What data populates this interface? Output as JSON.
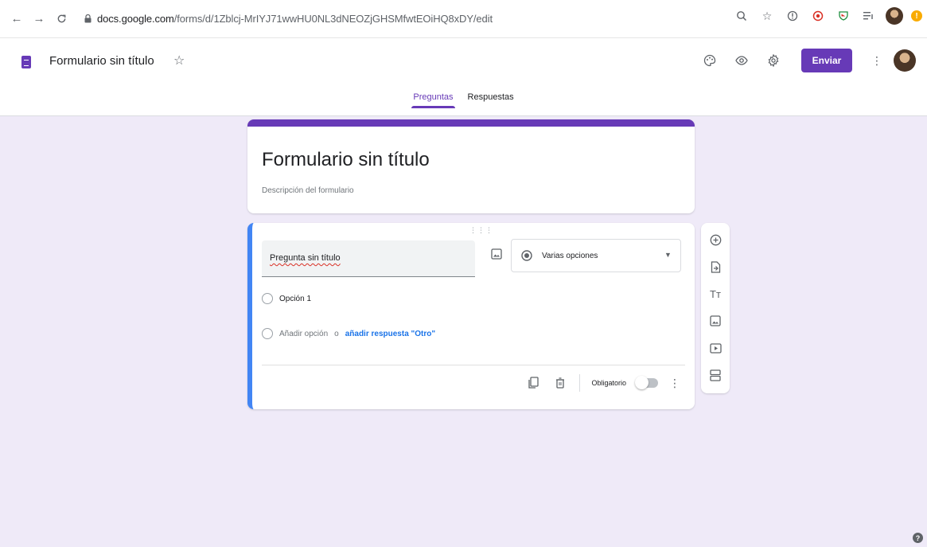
{
  "browser": {
    "url_host": "docs.google.com",
    "url_path": "/forms/d/1Zblcj-MrIYJ71wwHU0NL3dNEOZjGHSMfwtEOiHQ8xDY/edit",
    "icons": [
      "back-icon",
      "forward-icon",
      "reload-icon",
      "lock-icon",
      "zoom-icon",
      "star-icon",
      "extension-icons",
      "profile-avatar",
      "update-warning-icon"
    ],
    "warning_badge": "!"
  },
  "header": {
    "doc_title": "Formulario sin título",
    "send_label": "Enviar",
    "accent_color": "#673ab7",
    "tabs": [
      {
        "label": "Preguntas",
        "active": true
      },
      {
        "label": "Respuestas",
        "active": false
      }
    ]
  },
  "form": {
    "title": "Formulario sin título",
    "description_placeholder": "Descripción del formulario"
  },
  "question": {
    "title": "Pregunta sin título",
    "type_label": "Varias opciones",
    "options": [
      {
        "label": "Opción 1"
      }
    ],
    "add_option_label": "Añadir opción",
    "separator": "o",
    "add_other_label": "añadir respuesta \"Otro\"",
    "required_label": "Obligatorio",
    "required_on": false
  },
  "side_toolbar": {
    "icons": [
      "add-question-icon",
      "import-questions-icon",
      "add-title-icon",
      "add-image-icon",
      "add-video-icon",
      "add-section-icon"
    ],
    "title_glyph": "Tт"
  },
  "help": {
    "glyph": "?"
  }
}
